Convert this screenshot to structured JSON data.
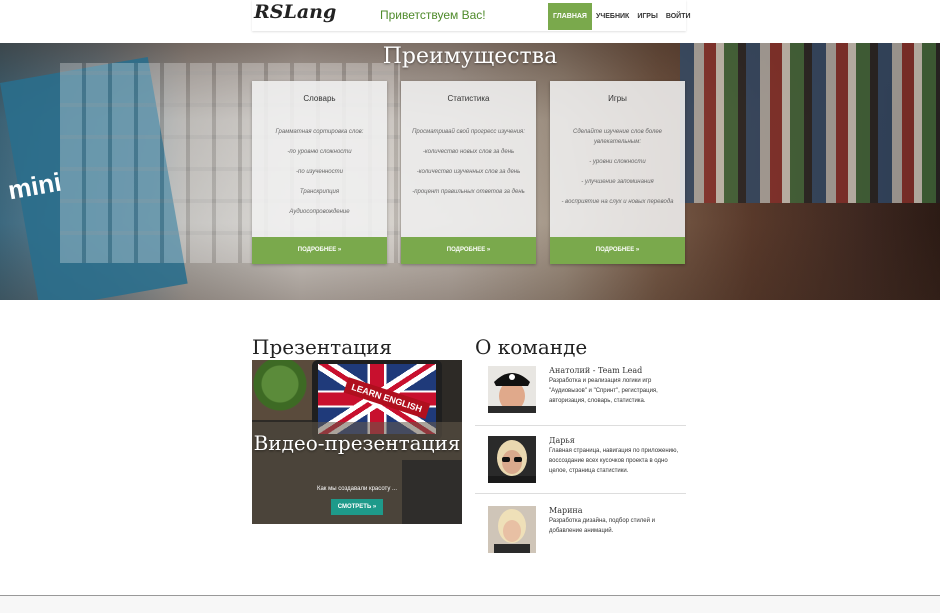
{
  "header": {
    "logo": "RSLang",
    "greeting": "Приветствуем Вас!",
    "nav": [
      {
        "label": "ГЛАВНАЯ",
        "active": true
      },
      {
        "label": "УЧЕБНИК",
        "active": false
      },
      {
        "label": "ИГРЫ",
        "active": false
      },
      {
        "label": "ВОЙТИ",
        "active": false
      }
    ]
  },
  "hero": {
    "title": "Преимущества",
    "cards": [
      {
        "title": "Словарь",
        "lines": [
          "Грамматная сортировка слов:",
          "-по уровню сложности",
          "-по изученности",
          "Транскрипция",
          "Аудиосопровождение"
        ],
        "button": "ПОДРОБНЕЕ »"
      },
      {
        "title": "Статистика",
        "lines": [
          "Просматривай свой прогресс изучения:",
          "-количество новых слов за день",
          "-количество изученных слов за день",
          "-процент правильных ответов за день"
        ],
        "button": "ПОДРОБНЕЕ »"
      },
      {
        "title": "Игры",
        "lines": [
          "Сделайте изучение слов более увлекательным:",
          "- уровни сложности",
          "- улучшение запоминания",
          "- восприятие на слух и новых перевода"
        ],
        "button": "ПОДРОБНЕЕ »"
      }
    ],
    "book_text": "mini"
  },
  "presentation": {
    "section_title": "Презентация",
    "learn_badge": "LEARN ENGLISH",
    "title": "Видео-презентация",
    "subtitle": "Как мы создавали красоту ...",
    "button": "СМОТРЕТЬ »"
  },
  "team": {
    "section_title": "О команде",
    "members": [
      {
        "name": "Анатолий - Team Lead",
        "desc": "Разработка и реализация логики игр \"Аудиовызов\" и \"Спринт\", регистрация, авторизация, словарь, статистика.",
        "avatar_color": "#5b4a3f"
      },
      {
        "name": "Дарья",
        "desc": "Главная страница, навигация по приложению, воссоздание всех кусочков проекта в одно целое, страница статистики.",
        "avatar_color": "#3a3a3a"
      },
      {
        "name": "Марина",
        "desc": "Разработка дизайна, подбор стилей и добавление анимаций.",
        "avatar_color": "#d9cfc2"
      }
    ]
  },
  "colors": {
    "accent_green": "#7aa94c",
    "greeting_green": "#4e8a2a",
    "teal_button": "#1e9a8a"
  }
}
